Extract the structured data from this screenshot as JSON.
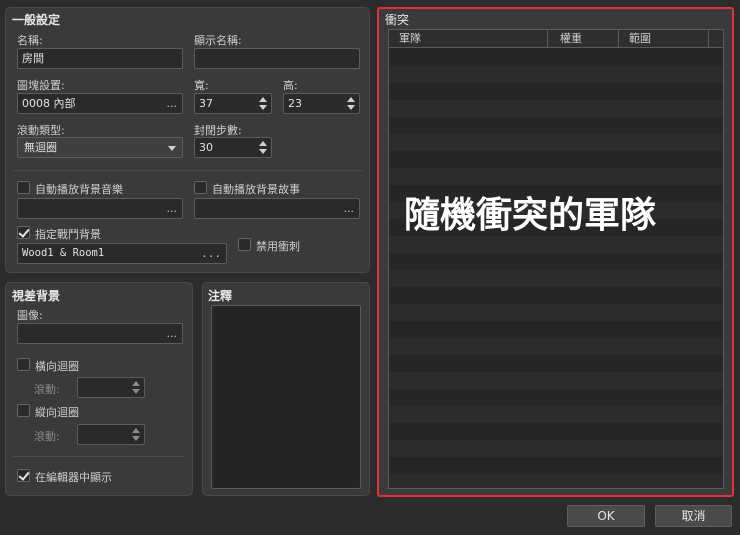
{
  "general": {
    "title": "一般設定",
    "name_label": "名稱:",
    "name_value": "房間",
    "display_name_label": "顯示名稱:",
    "display_name_value": "",
    "tileset_label": "圖塊設置:",
    "tileset_value": "0008 內部",
    "width_label": "寬:",
    "width_value": "37",
    "height_label": "高:",
    "height_value": "23",
    "scroll_type_label": "滾動類型:",
    "scroll_type_value": "無迴圈",
    "enc_steps_label": "封閉步數:",
    "enc_steps_value": "30",
    "autoplay_bgm_label": "自動播放背景音樂",
    "autoplay_bgm_checked": false,
    "autoplay_bgs_label": "自動播放背景故事",
    "autoplay_bgs_checked": false,
    "battleback_label": "指定戰鬥背景",
    "battleback_checked": true,
    "battleback_value": "Wood1 & Room1",
    "disable_dash_label": "禁用衝刺",
    "disable_dash_checked": false,
    "ellipsis": "..."
  },
  "parallax": {
    "title": "視差背景",
    "image_label": "圖像:",
    "image_value": "",
    "loop_h_label": "橫向迴圈",
    "loop_h_checked": false,
    "scroll_label": "滾動:",
    "loop_v_label": "縱向迴圈",
    "loop_v_checked": false,
    "show_in_editor_label": "在編輯器中顯示",
    "show_in_editor_checked": true
  },
  "note": {
    "title": "注釋",
    "value": ""
  },
  "encounters": {
    "title": "衝突",
    "columns": [
      "軍隊",
      "權重",
      "範圍"
    ],
    "overlay": "隨機衝突的軍隊"
  },
  "buttons": {
    "ok": "OK",
    "cancel": "取消"
  },
  "colors": {
    "highlight": "#e0303c"
  }
}
